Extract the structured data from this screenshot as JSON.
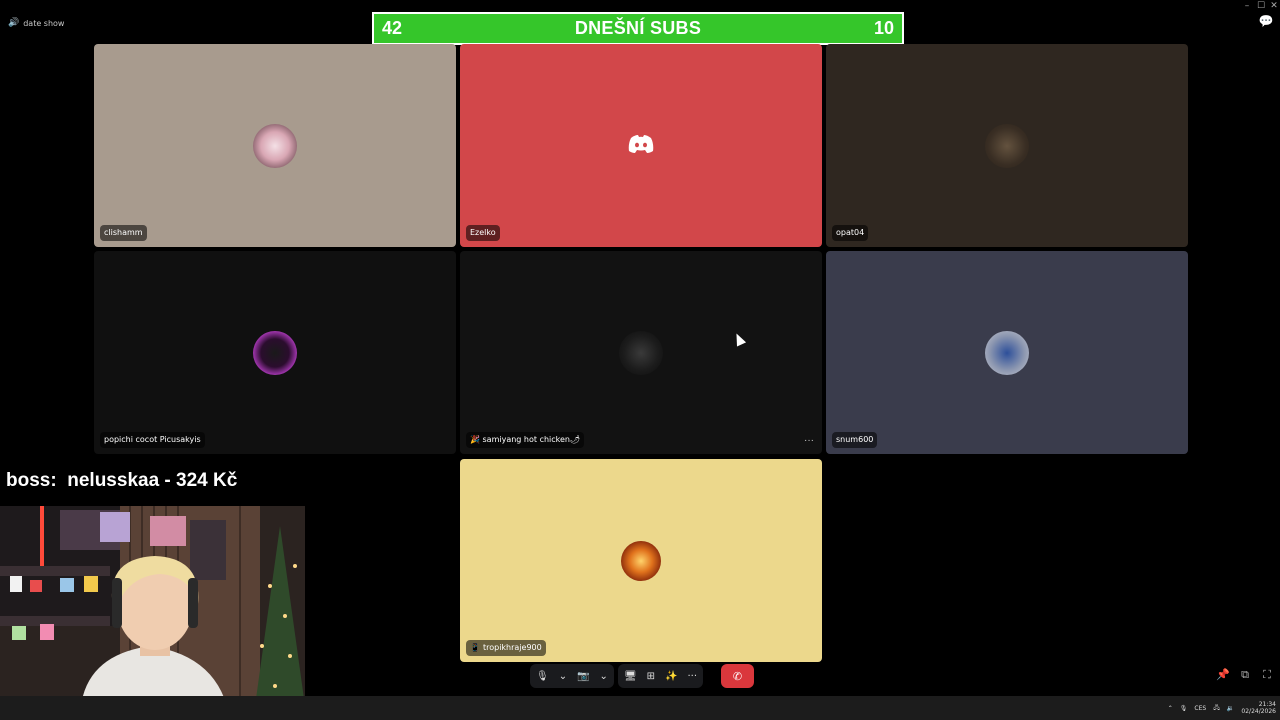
{
  "window": {
    "minimize": "–",
    "maximize": "☐",
    "close": "✕"
  },
  "channel": {
    "name": "date show"
  },
  "subs_banner": {
    "left_count": "42",
    "title": "DNEŠNÍ SUBS",
    "right_count": "10"
  },
  "participants": [
    {
      "name": "clishamm",
      "bg": "#a89b8e"
    },
    {
      "name": "Ezelko",
      "bg": "#d2474a"
    },
    {
      "name": "opat04",
      "bg": "#2f2720"
    },
    {
      "name": "popichi cocot Picusakyis",
      "bg": "#101010"
    },
    {
      "name": "🎉 samiyang hot chicken🌶",
      "bg": "#121212"
    },
    {
      "name": "snum600",
      "bg": "#3a3c4c"
    },
    {
      "name": "tropikhraje900",
      "bg": "#ecd88c"
    }
  ],
  "tile_more": "···",
  "boss": {
    "label": "boss:",
    "text": "nelusskaa - 324 Kč"
  },
  "controls": {
    "mic": "🎙",
    "cam": "📷",
    "share": "🖥",
    "activities": "⊞",
    "soundboard": "✨",
    "more": "···",
    "leave": "✆"
  },
  "tray": {
    "lang": "CES",
    "time": "21:34",
    "date": "02/24/2026"
  }
}
